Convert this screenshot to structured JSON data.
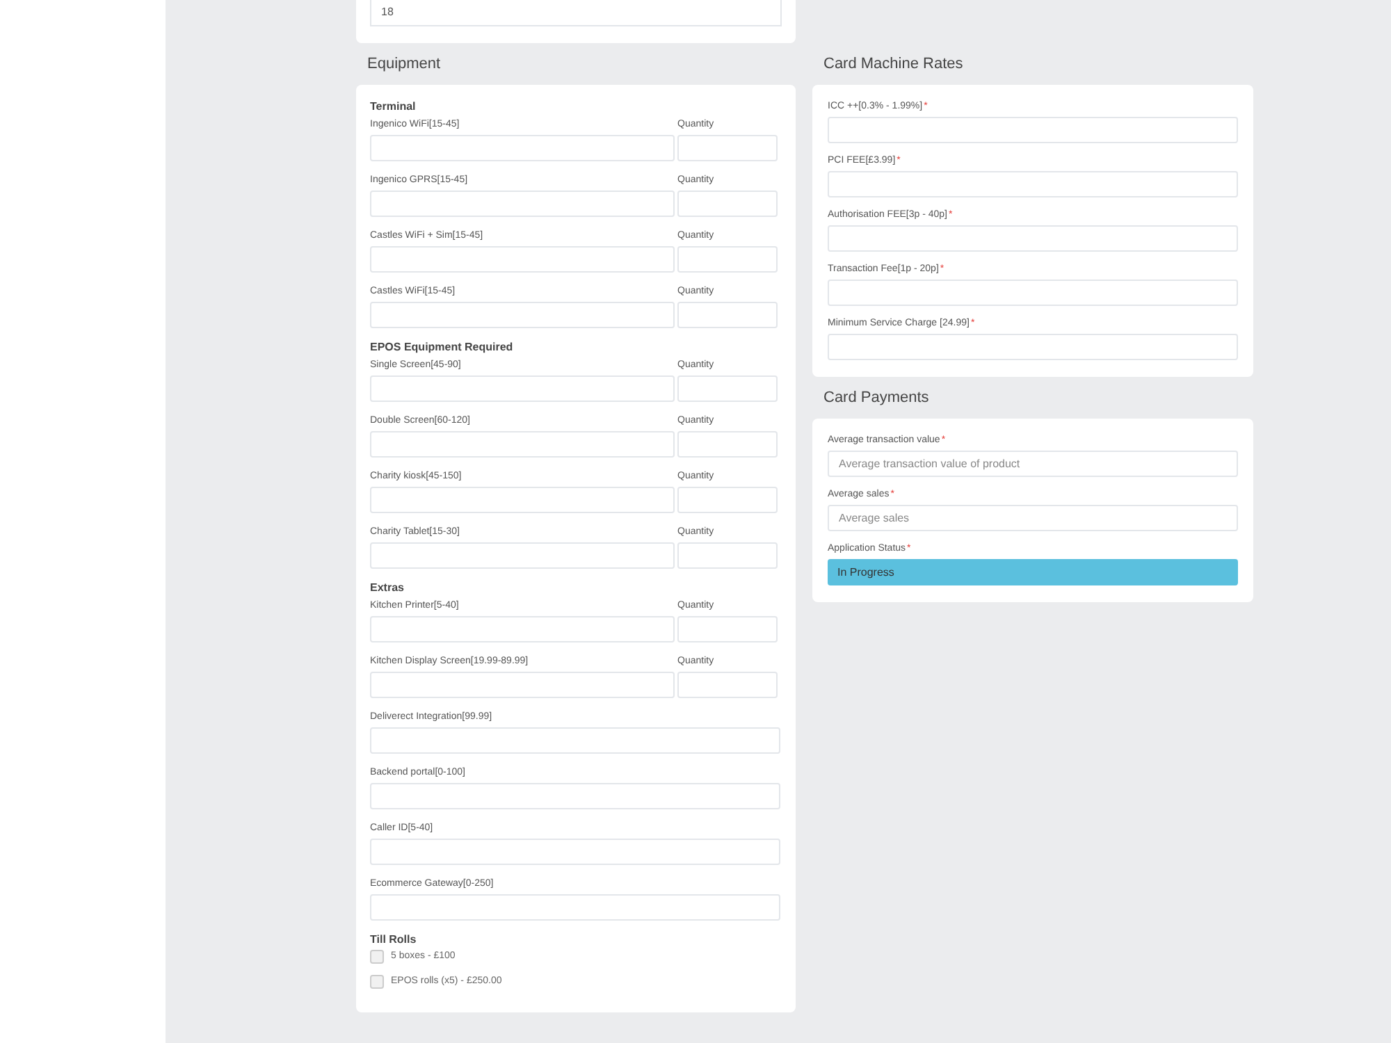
{
  "top_card": {
    "value": "18"
  },
  "equipment": {
    "title": "Equipment",
    "groups": [
      {
        "heading": "Terminal",
        "fields": [
          {
            "kind": "pair",
            "label": "Ingenico WiFi[15-45]",
            "quantity_label": "Quantity"
          },
          {
            "kind": "pair",
            "label": "Ingenico GPRS[15-45]",
            "quantity_label": "Quantity"
          },
          {
            "kind": "pair",
            "label": "Castles WiFi + Sim[15-45]",
            "quantity_label": "Quantity"
          },
          {
            "kind": "pair",
            "label": "Castles WiFi[15-45]",
            "quantity_label": "Quantity"
          }
        ]
      },
      {
        "heading": "EPOS Equipment Required",
        "fields": [
          {
            "kind": "pair",
            "label": "Single Screen[45-90]",
            "quantity_label": "Quantity"
          },
          {
            "kind": "pair",
            "label": "Double Screen[60-120]",
            "quantity_label": "Quantity"
          },
          {
            "kind": "pair",
            "label": "Charity kiosk[45-150]",
            "quantity_label": "Quantity"
          },
          {
            "kind": "pair",
            "label": "Charity Tablet[15-30]",
            "quantity_label": "Quantity"
          }
        ]
      },
      {
        "heading": "Extras",
        "fields": [
          {
            "kind": "pair",
            "label": "Kitchen Printer[5-40]",
            "quantity_label": "Quantity"
          },
          {
            "kind": "pair",
            "label": "Kitchen Display Screen[19.99-89.99]",
            "quantity_label": "Quantity"
          },
          {
            "kind": "single",
            "label": "Deliverect Integration[99.99]"
          },
          {
            "kind": "single",
            "label": "Backend portal[0-100]"
          },
          {
            "kind": "single",
            "label": "Caller ID[5-40]"
          },
          {
            "kind": "single",
            "label": "Ecommerce Gateway[0-250]"
          }
        ]
      },
      {
        "heading": "Till Rolls",
        "fields": [
          {
            "kind": "checkbox",
            "label": "5 boxes - £100",
            "checked": false
          },
          {
            "kind": "checkbox",
            "label": "EPOS rolls (x5) - £250.00",
            "checked": false
          }
        ]
      }
    ]
  },
  "card_machine_rates": {
    "title": "Card Machine Rates",
    "fields": [
      {
        "kind": "text",
        "label": "ICC ++[0.3% - 1.99%]",
        "required_mark": "*"
      },
      {
        "kind": "text",
        "label": "PCI FEE[£3.99]",
        "required_mark": "*"
      },
      {
        "kind": "text",
        "label": "Authorisation FEE[3p - 40p] ",
        "required_mark": "*"
      },
      {
        "kind": "text",
        "label": "Transaction Fee[1p - 20p] ",
        "required_mark": "*"
      },
      {
        "kind": "text",
        "label": "Minimum Service Charge [24.99] ",
        "required_mark": "*"
      }
    ]
  },
  "card_payments": {
    "title": "Card Payments",
    "fields": [
      {
        "kind": "text",
        "label": "Average transaction value ",
        "required_mark": "*",
        "placeholder": "Average transaction value of product"
      },
      {
        "kind": "text",
        "label": "Average sales ",
        "required_mark": "*",
        "placeholder": "Average sales"
      },
      {
        "kind": "select",
        "label": "Application Status ",
        "required_mark": "*",
        "value": "In Progress"
      }
    ]
  }
}
